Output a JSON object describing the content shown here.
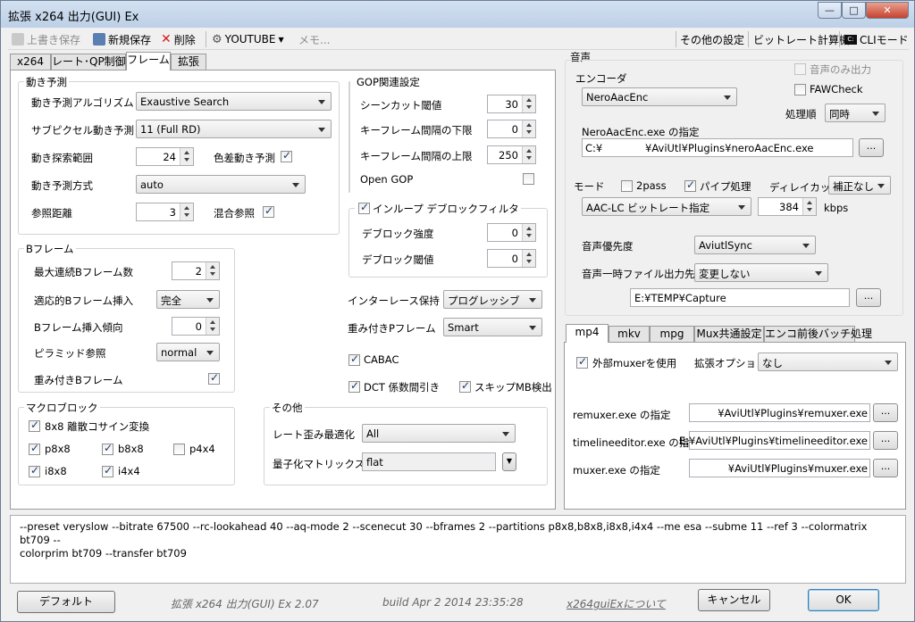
{
  "window": {
    "title": "拡張 x264 出力(GUI) Ex",
    "minimize": "—",
    "maximize": "□",
    "close": "✕"
  },
  "toolbar": {
    "overwrite": "上書き保存",
    "save_new": "新規保存",
    "delete": "削除",
    "profile": "YOUTUBE",
    "memo": "メモ...",
    "other_settings": "その他の設定",
    "bitrate_calc": "ビットレート計算機",
    "cli_mode": "CLIモード"
  },
  "tabs": [
    "x264",
    "レート･QP制御",
    "フレーム",
    "拡張"
  ],
  "motion": {
    "title": "動き予測",
    "algo_label": "動き予測アルゴリズム",
    "algo_value": "Exaustive Search",
    "subpel_label": "サブピクセル動き予測",
    "subpel_value": "11 (Full RD)",
    "range_label": "動き探索範囲",
    "range_value": "24",
    "chroma_label": "色差動き予測",
    "method_label": "動き予測方式",
    "method_value": "auto",
    "ref_label": "参照距離",
    "ref_value": "3",
    "mixed_label": "混合参照"
  },
  "gop": {
    "title": "GOP関連設定",
    "scenecut_label": "シーンカット閾値",
    "scenecut_value": "30",
    "keymin_label": "キーフレーム間隔の下限",
    "keymin_value": "0",
    "keymax_label": "キーフレーム間隔の上限",
    "keymax_value": "250",
    "opengop_label": "Open GOP"
  },
  "deblock": {
    "title": "インループ デブロックフィルタ",
    "strength_label": "デブロック強度",
    "strength_value": "0",
    "threshold_label": "デブロック閾値",
    "threshold_value": "0"
  },
  "bframe": {
    "title": "Bフレーム",
    "max_label": "最大連続Bフレーム数",
    "max_value": "2",
    "adapt_label": "適応的Bフレーム挿入",
    "adapt_value": "完全",
    "bias_label": "Bフレーム挿入傾向",
    "bias_value": "0",
    "pyramid_label": "ピラミッド参照",
    "pyramid_value": "normal",
    "weightb_label": "重み付きBフレーム"
  },
  "misc1": {
    "interlace_label": "インターレース保持",
    "interlace_value": "プログレッシブ",
    "weightp_label": "重み付きPフレーム",
    "weightp_value": "Smart",
    "cabac": "CABAC",
    "dct": "DCT 係数間引き",
    "skip": "スキップMB検出"
  },
  "macroblock": {
    "title": "マクロブロック",
    "dct8": "8x8 離散コサイン変換",
    "p8x8": "p8x8",
    "b8x8": "b8x8",
    "p4x4": "p4x4",
    "i8x8": "i8x8",
    "i4x4": "i4x4"
  },
  "other": {
    "title": "その他",
    "trellis_label": "レート歪み最適化",
    "trellis_value": "All",
    "cqm_label": "量子化マトリックス",
    "cqm_value": "flat",
    "cqm_btn": "▼"
  },
  "audio": {
    "title": "音声",
    "encoder_label": "エンコーダ",
    "encoder_value": "NeroAacEnc",
    "only_label": "音声のみ出力",
    "faw_label": "FAWCheck",
    "order_label": "処理順",
    "order_value": "同時",
    "path_label": "NeroAacEnc.exe の指定",
    "path_prefix": "C:¥",
    "path_rest": "¥AviUtl¥Plugins¥neroAacEnc.exe",
    "path_btn": "...",
    "mode_label": "モード",
    "pass_label": "2pass",
    "pipe_label": "パイプ処理",
    "delay_label": "ディレイカット",
    "delay_value": "補正なし",
    "mode_value": "AAC-LC ビットレート指定",
    "kbps_value": "384",
    "kbps_unit": "kbps",
    "priority_label": "音声優先度",
    "priority_value": "AviutlSync",
    "tmp_label": "音声一時ファイル出力先",
    "tmp_value": "変更しない",
    "tmp_path": "E:¥TEMP¥Capture",
    "tmp_btn": "..."
  },
  "mux": {
    "tabs": [
      "mp4",
      "mkv",
      "mpg",
      "Mux共通設定",
      "エンコ前後バッチ処理"
    ],
    "ext_label": "外部muxerを使用",
    "opt_label": "拡張オプション",
    "opt_value": "なし",
    "remuxer_label": "remuxer.exe の指定",
    "remuxer_value": "¥AviUtl¥Plugins¥remuxer.exe",
    "tle_label": "timelineeditor.exe の指定",
    "tle_value": "E:¥AviUtl¥Plugins¥timelineeditor.exe",
    "muxer_label": "muxer.exe の指定",
    "muxer_value": "¥AviUtl¥Plugins¥muxer.exe",
    "btn": "..."
  },
  "cmdline": {
    "line1": "--preset veryslow --bitrate 67500 --rc-lookahead 40 --aq-mode 2 --scenecut 30 --bframes 2 --partitions p8x8,b8x8,i8x8,i4x4 --me esa --subme 11 --ref 3 --colormatrix bt709 --",
    "line2": "colorprim bt709 --transfer bt709"
  },
  "footer": {
    "default": "デフォルト",
    "version": "拡張 x264 出力(GUI) Ex 2.07",
    "build": "build Apr  2 2014 23:35:28",
    "about": "x264guiExについて",
    "cancel": "キャンセル",
    "ok": "OK"
  }
}
